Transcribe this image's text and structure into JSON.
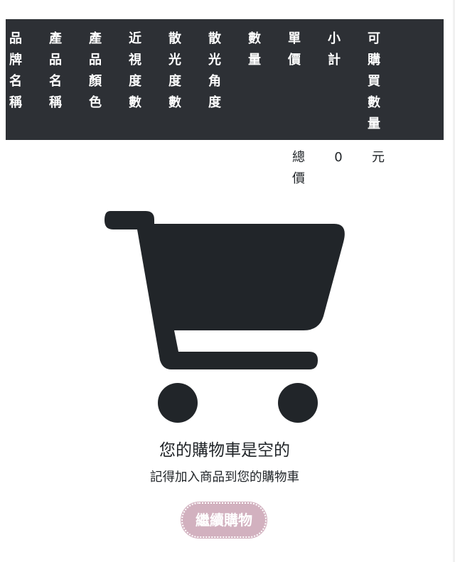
{
  "table": {
    "headers": [
      {
        "chars": [
          "品",
          "牌",
          "名",
          "稱"
        ]
      },
      {
        "chars": [
          "產",
          "品",
          "名",
          "稱"
        ]
      },
      {
        "chars": [
          "產",
          "品",
          "顏",
          "色"
        ]
      },
      {
        "chars": [
          "近",
          "視",
          "度",
          "數"
        ]
      },
      {
        "chars": [
          "散",
          "光",
          "度",
          "數"
        ]
      },
      {
        "chars": [
          "散",
          "光",
          "角",
          "度"
        ]
      },
      {
        "chars": [
          "數",
          "量"
        ]
      },
      {
        "chars": [
          "單",
          "價"
        ]
      },
      {
        "chars": [
          "小",
          "計"
        ]
      },
      {
        "chars": [
          "可",
          "購",
          "買",
          "數",
          "量"
        ]
      }
    ],
    "totals": {
      "label_chars": [
        "總",
        "價"
      ],
      "value": "0",
      "currency": "元"
    }
  },
  "empty_cart": {
    "icon": "shopping-cart-icon",
    "title": "您的購物車是空的",
    "subtitle": "記得加入商品到您的購物車",
    "button_label": "繼續購物"
  },
  "colors": {
    "header_bg": "#2d3035",
    "cart_icon": "#212529",
    "button_bg": "#d2b1bf"
  }
}
